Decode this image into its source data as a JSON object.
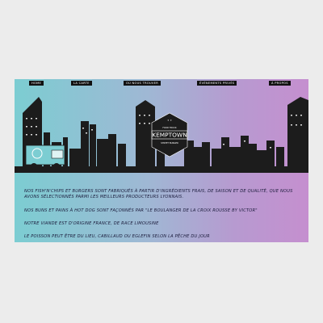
{
  "nav": {
    "items": [
      {
        "label": "HOME"
      },
      {
        "label": "LA CARTE"
      },
      {
        "label": "OÙ NOUS TROUVER"
      },
      {
        "label": "ÉVÉNEMENTS PRIVÉS"
      },
      {
        "label": "À PROPOS"
      }
    ]
  },
  "logo": {
    "top_text": "FOOD TRUCK",
    "name": "KEMPTOWN",
    "bottom_text": "STREET BURGER"
  },
  "content": {
    "p1": "NOS FISH'N'CHIPS ET BURGERS SONT FABRIQUÉS À PARTIR D'INGRÉDIENTS FRAIS, DE SAISON ET DE QUALITÉ, QUE NOUS AVONS SÉLECTIONNÉS PARMI LES MEILLEURS PRODUCTEURS LYONNAIS.",
    "p2": "NOS BUNS ET PAINS À HOT DOG SONT FAÇONNÉS PAR \"LE BOULANGER DE LA CROIX ROUSSE BY VICTOR\"",
    "p3": "NOTRE VIANDE EST D'ORIGINE FRANCE, DE RACE LIMOUSINE",
    "p4": "LE POISSON PEUT ÊTRE DU LIEU, CABILLAUD OU EGLEFIN SELON LA PÊCHE DU JOUR"
  },
  "colors": {
    "gradient_left": "#7ccdd2",
    "gradient_right": "#c58fcf",
    "skyline": "#1c1c1c",
    "truck": "#7ccdd2"
  }
}
